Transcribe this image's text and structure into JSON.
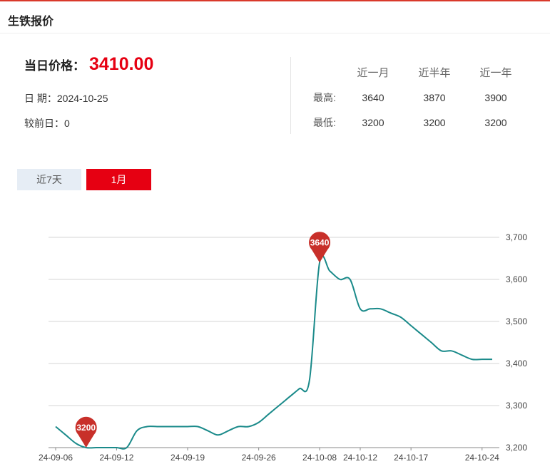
{
  "header": {
    "title": "生铁报价"
  },
  "price": {
    "label": "当日价格：",
    "value": "3410.00"
  },
  "info": {
    "date": "日 期：2024-10-25",
    "change": "较前日：0"
  },
  "stats": {
    "columns": [
      "近一月",
      "近半年",
      "近一年"
    ],
    "rows": [
      {
        "label": "最高:",
        "values": [
          "3640",
          "3870",
          "3900"
        ]
      },
      {
        "label": "最低:",
        "values": [
          "3200",
          "3200",
          "3200"
        ]
      }
    ]
  },
  "tabs": [
    {
      "label": "近7天",
      "active": false
    },
    {
      "label": "1月",
      "active": true
    }
  ],
  "colors": {
    "accent": "#e60012",
    "line": "#1a8a8a",
    "pin": "#c8302a"
  },
  "chart_data": {
    "type": "line",
    "x": [
      "24-09-06",
      "24-09-07",
      "24-09-08",
      "24-09-09",
      "24-09-10",
      "24-09-11",
      "24-09-12",
      "24-09-13",
      "24-09-14",
      "24-09-15",
      "24-09-16",
      "24-09-17",
      "24-09-18",
      "24-09-19",
      "24-09-20",
      "24-09-21",
      "24-09-22",
      "24-09-23",
      "24-09-24",
      "24-09-25",
      "24-09-26",
      "24-09-27",
      "24-09-28",
      "24-09-29",
      "24-09-30",
      "24-10-01",
      "24-10-08",
      "24-10-09",
      "24-10-10",
      "24-10-11",
      "24-10-12",
      "24-10-13",
      "24-10-14",
      "24-10-15",
      "24-10-16",
      "24-10-17",
      "24-10-18",
      "24-10-19",
      "24-10-20",
      "24-10-21",
      "24-10-22",
      "24-10-23",
      "24-10-24",
      "24-10-25"
    ],
    "series": [
      {
        "values": [
          3250,
          3230,
          3210,
          3200,
          3200,
          3200,
          3200,
          3200,
          3240,
          3250,
          3250,
          3250,
          3250,
          3250,
          3250,
          3240,
          3230,
          3240,
          3250,
          3250,
          3260,
          3280,
          3300,
          3320,
          3340,
          3360,
          3640,
          3620,
          3600,
          3600,
          3530,
          3530,
          3530,
          3520,
          3510,
          3490,
          3470,
          3450,
          3430,
          3430,
          3420,
          3410,
          3410,
          3410
        ]
      }
    ],
    "x_tick_labels": [
      "24-09-06",
      "24-09-12",
      "24-09-19",
      "24-09-26",
      "24-10-08",
      "24-10-12",
      "24-10-17",
      "24-10-24"
    ],
    "y_ticks": [
      3200,
      3300,
      3400,
      3500,
      3600,
      3700
    ],
    "y_tick_labels": [
      "3,200",
      "3,300",
      "3,400",
      "3,500",
      "3,600",
      "3,700"
    ],
    "ylim": [
      3200,
      3700
    ],
    "y_axis_side": "right",
    "grid": true,
    "annotations": [
      {
        "label": "3200",
        "x": "24-09-09",
        "value": 3200
      },
      {
        "label": "3640",
        "x": "24-10-08",
        "value": 3640
      }
    ]
  }
}
